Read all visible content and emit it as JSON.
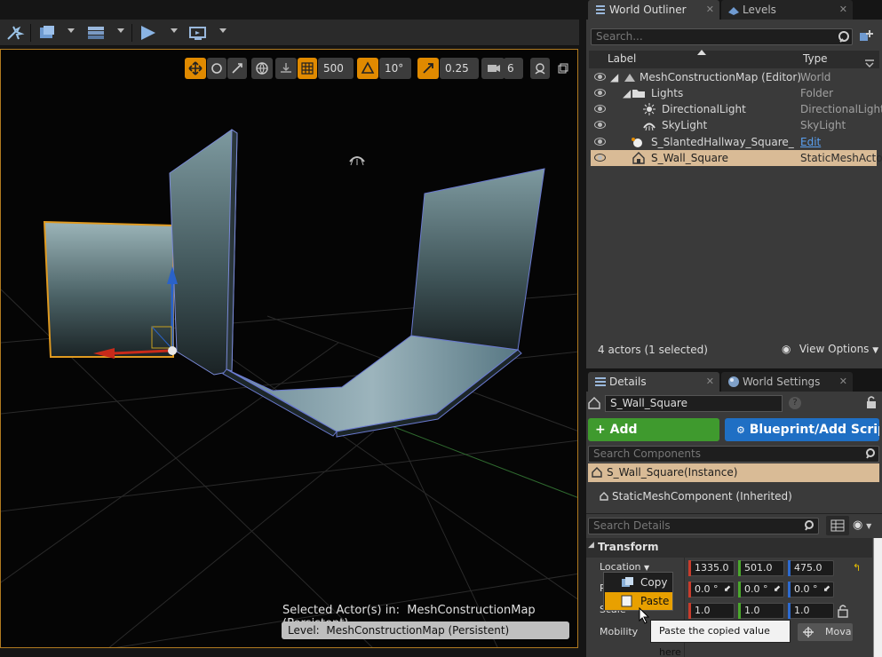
{
  "toolbar": {
    "buttons": [
      "modes-icon",
      "content-icon",
      "build-icon",
      "play-icon",
      "launch-icon"
    ]
  },
  "viewport": {
    "grid_snap": "500",
    "rotation_snap": "10°",
    "scale_snap": "0.25",
    "camera_speed": "6",
    "selected_actor_label": "Selected Actor(s) in:",
    "selected_actor_map": "MeshConstructionMap (Persistent)",
    "level_label": "Level:",
    "level_name": "MeshConstructionMap (Persistent)"
  },
  "outliner": {
    "tabs": [
      {
        "label": "World Outliner"
      },
      {
        "label": "Levels"
      }
    ],
    "search_placeholder": "Search...",
    "columns": {
      "label": "Label",
      "type": "Type"
    },
    "rows": [
      {
        "name": "MeshConstructionMap (Editor)",
        "type": "World"
      },
      {
        "name": "Lights",
        "type": "Folder"
      },
      {
        "name": "DirectionalLight",
        "type": "DirectionalLight"
      },
      {
        "name": "SkyLight",
        "type": "SkyLight"
      },
      {
        "name": "S_SlantedHallway_Square_",
        "type": "Edit S_SlantedH"
      },
      {
        "name": "S_Wall_Square",
        "type": "StaticMeshActor"
      }
    ],
    "actor_count": "4 actors (1 selected)",
    "view_options": "View Options"
  },
  "details": {
    "tabs": [
      {
        "label": "Details"
      },
      {
        "label": "World Settings"
      }
    ],
    "actor_name": "S_Wall_Square",
    "add_component": "+ Add Component",
    "blueprint": "Blueprint/Add Scrip",
    "search_components": "Search Components",
    "instance": "S_Wall_Square(Instance)",
    "component": "StaticMeshComponent (Inherited)",
    "search_details": "Search Details",
    "transform_header": "Transform",
    "location_label": "Location",
    "rotation_label": "R",
    "scale_label": "Scale",
    "location": [
      "1335.0",
      "501.0",
      "475.0"
    ],
    "rotation": [
      "0.0 °",
      "0.0 °",
      "0.0 °"
    ],
    "scale": [
      "1.0",
      "1.0",
      "1.0"
    ],
    "mobility_label": "Mobility",
    "mobility_value": "Mova"
  },
  "context_menu": {
    "copy": "Copy",
    "paste": "Paste"
  },
  "tooltip": "Paste the copied value here",
  "colors": {
    "accent": "#e08a00",
    "selection": "#d9bb96",
    "add_component": "#3f9a2e",
    "blueprint": "#1f6fc4"
  }
}
